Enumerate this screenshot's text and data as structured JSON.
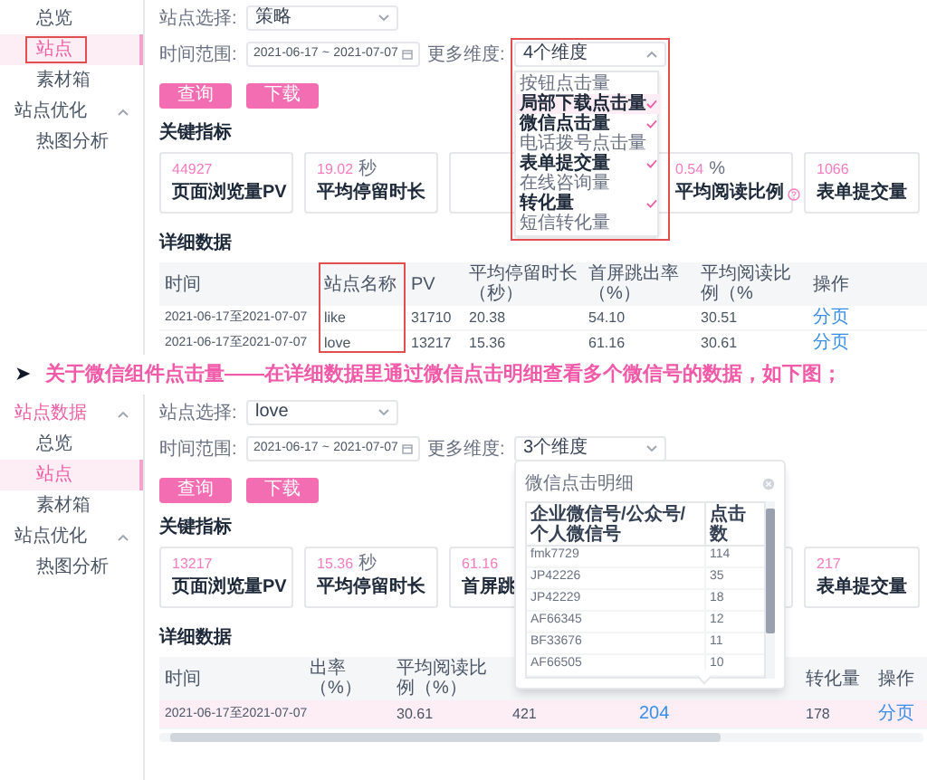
{
  "screenshot_1": {
    "sidebar": [
      {
        "label": "总览",
        "kind": "item",
        "selected": false
      },
      {
        "label": "站点",
        "kind": "item",
        "selected": true,
        "annotated": true
      },
      {
        "label": "素材箱",
        "kind": "item",
        "selected": false
      },
      {
        "label": "站点优化",
        "kind": "group",
        "active": false,
        "expanded": true
      },
      {
        "label": "热图分析",
        "kind": "item",
        "selected": false
      }
    ],
    "site_select": {
      "label": "站点选择:",
      "value": "策略"
    },
    "date_range": {
      "label": "时间范围:",
      "start": "2021-06-17",
      "separator": "~",
      "end": "2021-07-07"
    },
    "dimensions": {
      "label": "更多维度:",
      "value": "4个维度",
      "expanded": true,
      "annotated": true,
      "options": [
        {
          "label": "按钮点击量",
          "checked": false,
          "hovered": false
        },
        {
          "label": "局部下载点击量",
          "checked": true,
          "hovered": true
        },
        {
          "label": "微信点击量",
          "checked": true,
          "hovered": false
        },
        {
          "label": "电话拨号点击量",
          "checked": false,
          "hovered": false
        },
        {
          "label": "表单提交量",
          "checked": true,
          "hovered": false
        },
        {
          "label": "在线咨询量",
          "checked": false,
          "hovered": false
        },
        {
          "label": "转化量",
          "checked": true,
          "hovered": false
        },
        {
          "label": "短信转化量",
          "checked": false,
          "hovered": false
        }
      ]
    },
    "buttons": [
      "查询",
      "下载"
    ],
    "metrics_title": "关键指标",
    "metrics": [
      {
        "value": "44927",
        "label": "页面浏览量PV"
      },
      {
        "value": "19.02",
        "unit": "秒",
        "label": "平均停留时长"
      },
      {
        "value": "0.54",
        "unit": "%",
        "label": "平均阅读比例",
        "help": true,
        "kind": "partial"
      },
      {
        "value": "1066",
        "label": "表单提交量"
      }
    ],
    "detail_title": "详细数据",
    "table": {
      "columns": [
        {
          "label": "时间",
          "kind": "text"
        },
        {
          "label": "站点名称",
          "kind": "text",
          "annotated": true
        },
        {
          "label": "PV",
          "kind": "text"
        },
        {
          "label": "平均停留时长（秒）",
          "kind": "text"
        },
        {
          "label": "首屏跳出率（%）",
          "kind": "text"
        },
        {
          "label": "平均阅读比例（%",
          "kind": "text"
        },
        {
          "label": "操作",
          "kind": "link"
        }
      ],
      "rows": [
        {
          "highlighted": false,
          "cells": [
            "2021-06-17至2021-07-07",
            "like",
            "31710",
            "20.38",
            "54.10",
            "30.51",
            "分页"
          ]
        },
        {
          "highlighted": false,
          "cells": [
            "2021-06-17至2021-07-07",
            "love",
            "13217",
            "15.36",
            "61.16",
            "30.61",
            "分页"
          ]
        }
      ]
    }
  },
  "caption": {
    "bullet": "➤",
    "text": "关于微信组件点击量——在详细数据里通过微信点击明细查看多个微信号的数据，如下图；"
  },
  "screenshot_2": {
    "sidebar": [
      {
        "label": "站点数据",
        "kind": "group",
        "active": true,
        "expanded": true
      },
      {
        "label": "总览",
        "kind": "item",
        "selected": false
      },
      {
        "label": "站点",
        "kind": "item",
        "selected": true
      },
      {
        "label": "素材箱",
        "kind": "item",
        "selected": false
      },
      {
        "label": "站点优化",
        "kind": "group",
        "active": false,
        "expanded": true
      },
      {
        "label": "热图分析",
        "kind": "item",
        "selected": false
      }
    ],
    "site_select": {
      "label": "站点选择:",
      "value": "love"
    },
    "date_range": {
      "label": "时间范围:",
      "start": "2021-06-17",
      "separator": "~",
      "end": "2021-07-07"
    },
    "dimensions": {
      "label": "更多维度:",
      "value": "3个维度",
      "expanded": false
    },
    "buttons": [
      "查询",
      "下载"
    ],
    "metrics_title": "关键指标",
    "metrics": [
      {
        "value": "13217",
        "label": "页面浏览量PV"
      },
      {
        "value": "15.36",
        "unit": "秒",
        "label": "平均停留时长"
      },
      {
        "value": "61.16",
        "label": "首屏跳"
      },
      {
        "value": "217",
        "label": "表单提交量"
      }
    ],
    "detail_title": "详细数据",
    "table": {
      "columns": [
        {
          "label": "时间",
          "kind": "text"
        },
        {
          "label": "出率（%）"
        },
        {
          "label": "平均阅读比例（%）",
          "kind": "text"
        },
        {
          "kind": "text"
        },
        {
          "kind": "link"
        },
        {
          "label": "转化量",
          "kind": "text"
        },
        {
          "label": "操作",
          "kind": "link"
        }
      ],
      "rows": [
        {
          "highlighted": true,
          "cells": [
            "2021-06-17至2021-07-07",
            null,
            "30.61",
            "421",
            "204",
            "178",
            "分页"
          ]
        }
      ]
    },
    "popup": {
      "title": "微信点击明细",
      "columns": [
        "企业微信号/公众号/个人微信号",
        "点击数"
      ],
      "rows": [
        [
          "fmk7729",
          "114"
        ],
        [
          "JP42226",
          "35"
        ],
        [
          "JP42229",
          "18"
        ],
        [
          "AF66345",
          "12"
        ],
        [
          "BF33676",
          "11"
        ],
        [
          "AF66505",
          "10"
        ]
      ]
    }
  }
}
